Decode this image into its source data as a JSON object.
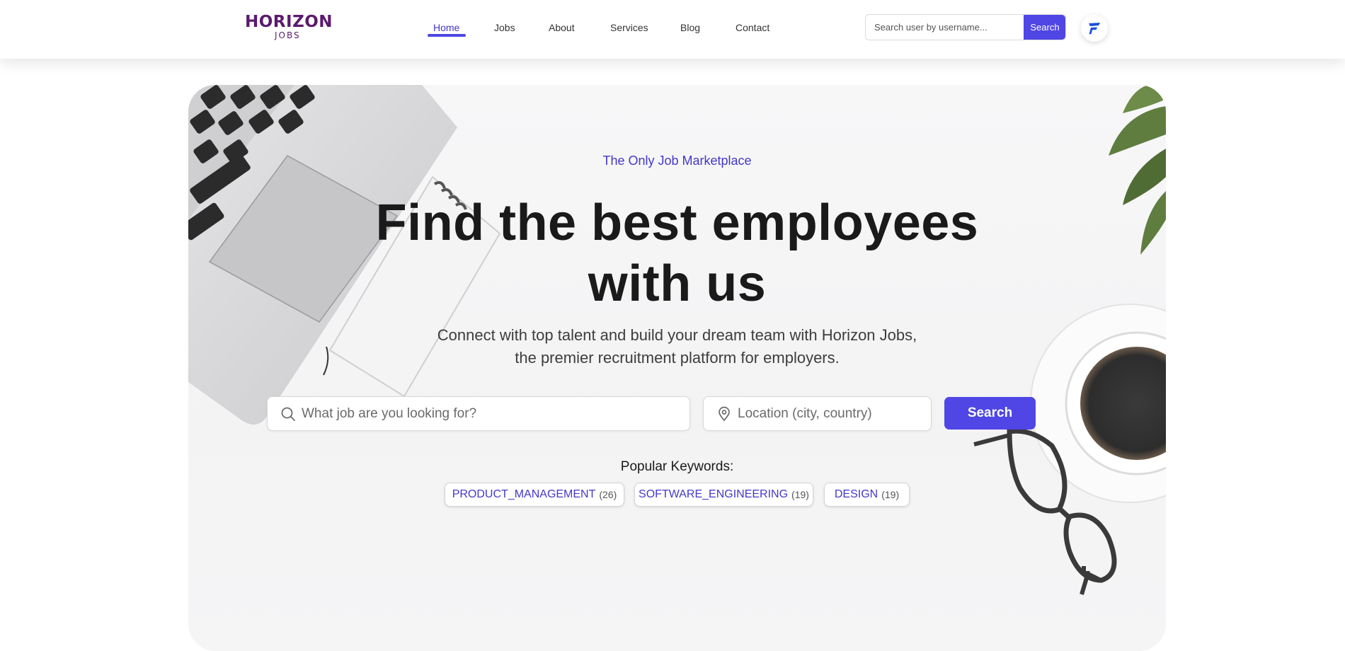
{
  "brand": {
    "logo_main": "HORIZON",
    "logo_sub": "JOBS"
  },
  "nav": {
    "items": [
      {
        "label": "Home",
        "active": true
      },
      {
        "label": "Jobs",
        "active": false
      },
      {
        "label": "About",
        "active": false
      },
      {
        "label": "Services",
        "active": false
      },
      {
        "label": "Blog",
        "active": false
      },
      {
        "label": "Contact",
        "active": false
      }
    ]
  },
  "user_search": {
    "placeholder": "Search user by username...",
    "button_label": "Search"
  },
  "hero": {
    "eyebrow": "The Only Job Marketplace",
    "title": "Find the best employees with us",
    "subtitle": "Connect with top talent and build your dream team with Horizon Jobs, the premier recruitment platform for employers.",
    "job_search": {
      "placeholder": "What job are you looking for?",
      "icon": "search-icon"
    },
    "location_search": {
      "placeholder": "Location (city, country)",
      "icon": "map-pin-icon"
    },
    "search_button_label": "Search",
    "keywords_label": "Popular Keywords:",
    "keywords": [
      {
        "label": "PRODUCT_MANAGEMENT",
        "count": "(26)"
      },
      {
        "label": "SOFTWARE_ENGINEERING",
        "count": "(19)"
      },
      {
        "label": "DESIGN",
        "count": "(19)"
      }
    ]
  },
  "colors": {
    "accent": "#4f46e5",
    "accent_text": "#4338ca",
    "logo": "#5b1a6e",
    "title": "#1a1a1a"
  }
}
